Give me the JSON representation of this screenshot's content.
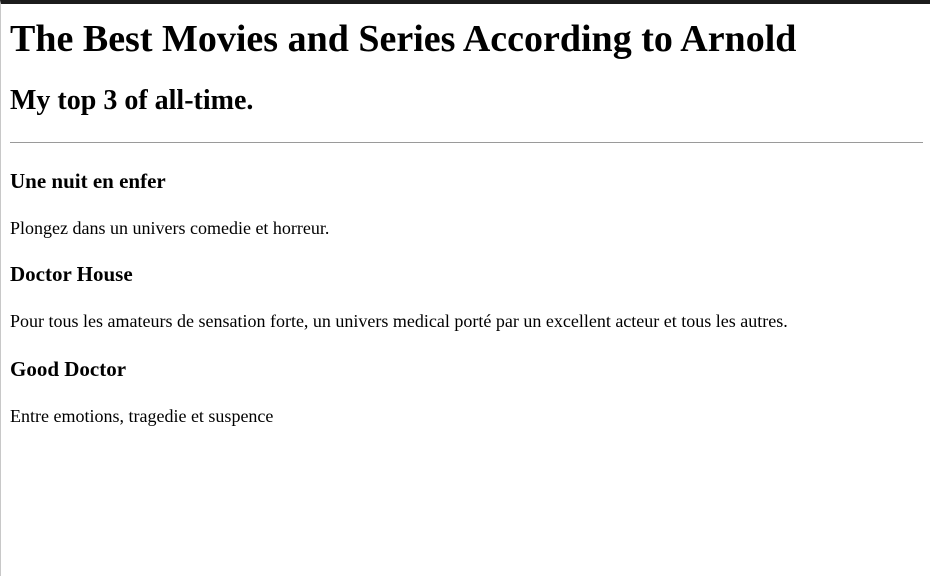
{
  "header": {
    "title": "The Best Movies and Series According to Arnold",
    "subtitle": "My top 3 of all-time."
  },
  "entries": [
    {
      "title": "Une nuit en enfer",
      "description": "Plongez dans un univers comedie et horreur."
    },
    {
      "title": "Doctor House",
      "description": "Pour tous les amateurs de sensation forte, un univers medical porté par un excellent acteur et tous les autres."
    },
    {
      "title": "Good Doctor",
      "description": "Entre emotions, tragedie et suspence"
    }
  ]
}
